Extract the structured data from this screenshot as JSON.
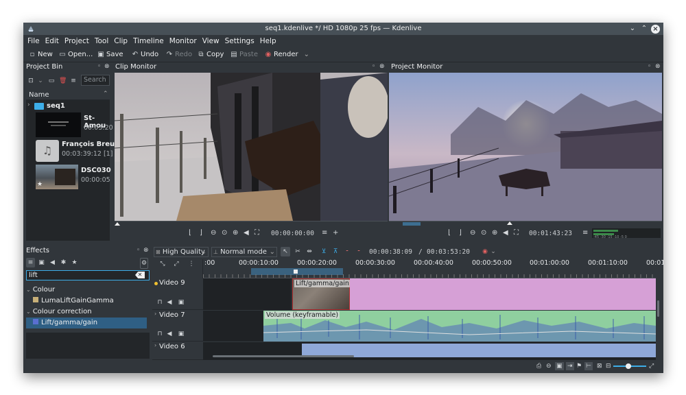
{
  "window": {
    "title": "seq1.kdenlive */ HD 1080p 25 fps — Kdenlive"
  },
  "menu": [
    "File",
    "Edit",
    "Project",
    "Tool",
    "Clip",
    "Timeline",
    "Monitor",
    "View",
    "Settings",
    "Help"
  ],
  "toolbar": {
    "new": "New",
    "open": "Open...",
    "save": "Save",
    "undo": "Undo",
    "redo": "Redo",
    "copy": "Copy",
    "paste": "Paste",
    "render": "Render"
  },
  "project_bin": {
    "title": "Project Bin",
    "search_placeholder": "Search",
    "column_name": "Name",
    "folder": "seq1",
    "clips": [
      {
        "title": "St-Amou",
        "sub": "00:03:20"
      },
      {
        "title": "François Breut",
        "sub": "00:03:39:12 [1]"
      },
      {
        "title": "DSC030",
        "sub": "00:00:05"
      }
    ]
  },
  "clip_monitor": {
    "title": "Clip Monitor",
    "timecode": "00:00:00:00"
  },
  "project_monitor": {
    "title": "Project Monitor",
    "timecode": "00:01:43:23",
    "levels": "-45 -30 -15 -10 -5 0"
  },
  "effects": {
    "title": "Effects",
    "search_value": "lift",
    "categories": [
      {
        "label": "Colour",
        "items": [
          "LumaLiftGainGamma"
        ]
      },
      {
        "label": "Colour correction",
        "items": [
          "Lift/gamma/gain"
        ]
      }
    ]
  },
  "timeline": {
    "quality": "High Quality",
    "mode": "Normal mode",
    "position": "00:00:38:09",
    "sep": "/",
    "duration": "00:03:53:20",
    "ruler": [
      ":00",
      "00:00:10:00",
      "00:00:20:00",
      "00:00:30:00",
      "00:00:40:00",
      "00:00:50:00",
      "00:01:00:00",
      "00:01:10:00",
      "00:01"
    ],
    "tracks": [
      {
        "name": "Video 9"
      },
      {
        "name": "Video 7"
      },
      {
        "name": "Video 6"
      }
    ],
    "clips": {
      "lift": "Lift/gamma/gain",
      "volume": "Volume (keyframable)"
    }
  },
  "colors": {
    "bg": "#31363b",
    "dark": "#232629",
    "accent": "#3daee9",
    "clip_pink": "#d6a0d6",
    "clip_audio": "#8fcf9f",
    "clip_blue": "#8fa8d8",
    "select": "#2f5f84"
  }
}
